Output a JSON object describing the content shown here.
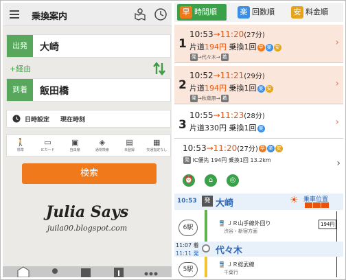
{
  "left": {
    "header": {
      "title": "乗換案内"
    },
    "departure": {
      "tag": "出発",
      "value": "大崎"
    },
    "via_label": "+経由",
    "arrival": {
      "tag": "到着",
      "value": "飯田橋"
    },
    "datetime": {
      "label": "日時設定",
      "value": "現在時刻"
    },
    "options": [
      {
        "icon": "walk-icon",
        "glyph": "🚶",
        "label": "標準"
      },
      {
        "icon": "ic-card-icon",
        "glyph": "▭",
        "label": "ICカード"
      },
      {
        "icon": "seat-icon",
        "glyph": "▣",
        "label": "自由席"
      },
      {
        "icon": "route-icon",
        "glyph": "◈",
        "label": "通常検索"
      },
      {
        "icon": "bus-icon",
        "glyph": "▤",
        "label": "未登録"
      },
      {
        "icon": "car-icon",
        "glyph": "▦",
        "label": "交通指定なし"
      }
    ],
    "search_label": "検索",
    "watermark": {
      "title": "Julia Says",
      "url": "juila00.blogspot.com"
    }
  },
  "right": {
    "tabs": [
      {
        "badge": "早",
        "label": "時間順",
        "color": "#f07a1b"
      },
      {
        "badge": "楽",
        "label": "回数順",
        "color": "#3a8ee6"
      },
      {
        "badge": "安",
        "label": "料金順",
        "color": "#e6a41a"
      }
    ],
    "routes": [
      {
        "num": "1",
        "dep": "10:53",
        "arr": "11:20",
        "dur": "(27分)",
        "fare_prefix": "片道",
        "price": "194円",
        "transfer": "乗換1回",
        "via": "→代々木→"
      },
      {
        "num": "2",
        "dep": "10:52",
        "arr": "11:21",
        "dur": "(29分)",
        "fare_prefix": "片道",
        "price": "194円",
        "transfer": "乗換1回",
        "via": "→秋葉原→"
      },
      {
        "num": "3",
        "dep": "10:55",
        "arr": "11:23",
        "dur": "(28分)",
        "fare_prefix": "片道",
        "price": "330円",
        "transfer": "乗換1回",
        "via": ""
      }
    ],
    "detail": {
      "dep": "10:53",
      "arr": "11:20",
      "dur": "(27分)",
      "info": "IC優先 194円 乗換1回 13.2km"
    },
    "timeline": {
      "row1_time": "10:53",
      "row1_badge": "発",
      "row1_station": "大崎",
      "seat_label": "乗車位置",
      "seg1_count": "6駅",
      "seg1_line": "ＪＲ山手線外回り",
      "seg1_dir": "渋谷・新宿方面",
      "fare_chip": "194円",
      "row2_time": "11:07 着",
      "row2_time2": "11:11 発",
      "row2_station": "代々木",
      "seg2_count": "5駅",
      "seg2_line": "ＪＲ総武線",
      "seg2_dir": "千葉行"
    }
  }
}
